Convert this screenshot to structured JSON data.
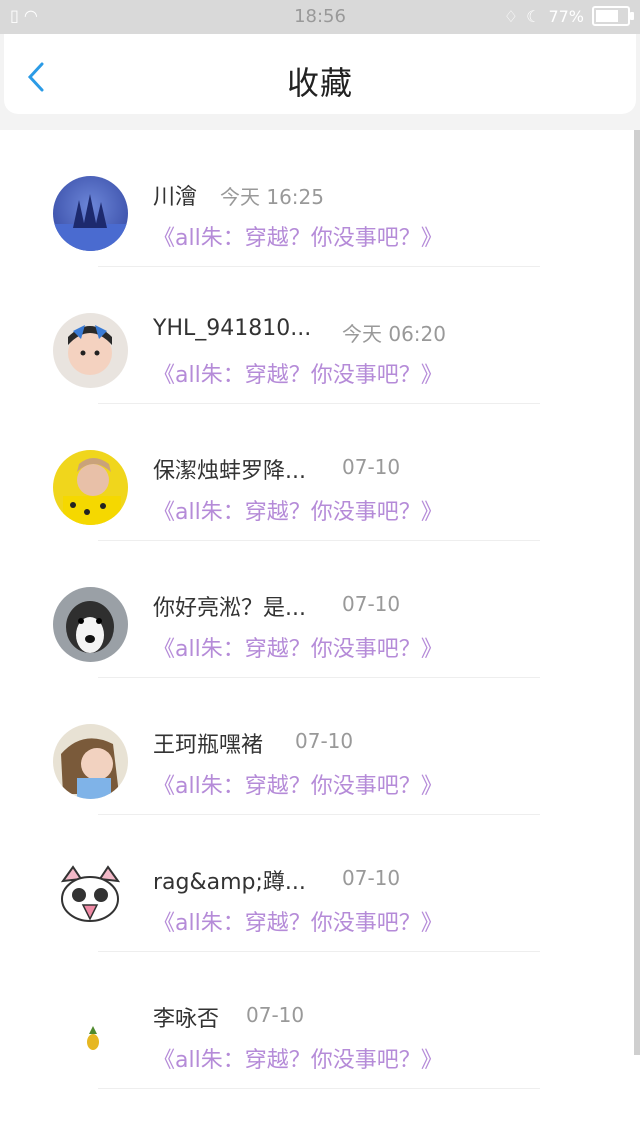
{
  "status_bar": {
    "time": "18:56",
    "battery": "77%",
    "battery_level": 0.77
  },
  "header": {
    "title": "收藏",
    "back_icon": "chevron-left-icon"
  },
  "items": [
    {
      "name": "川澮",
      "time": "今天 16:25",
      "subtitle": "《all朱：穿越？你没事吧？》"
    },
    {
      "name": "YHL_941810...",
      "time": "今天 06:20",
      "subtitle": "《all朱：穿越？你没事吧？》"
    },
    {
      "name": "保潔烛蚌罗降...",
      "time": "07-10",
      "subtitle": "《all朱：穿越？你没事吧？》"
    },
    {
      "name": "你好亮淞？是...",
      "time": "07-10",
      "subtitle": "《all朱：穿越？你没事吧？》"
    },
    {
      "name": "王珂瓶嘿褚",
      "time": "07-10",
      "subtitle": "《all朱：穿越？你没事吧？》"
    },
    {
      "name": "rag&amp;蹲...",
      "time": "07-10",
      "subtitle": "《all朱：穿越？你没事吧？》"
    },
    {
      "name": "李咏否",
      "time": "07-10",
      "subtitle": "《all朱：穿越？你没事吧？》"
    }
  ],
  "colors": {
    "accent": "#2b9be6",
    "subtitle": "#b58bd8",
    "statusbar": "#d9d9d9"
  }
}
